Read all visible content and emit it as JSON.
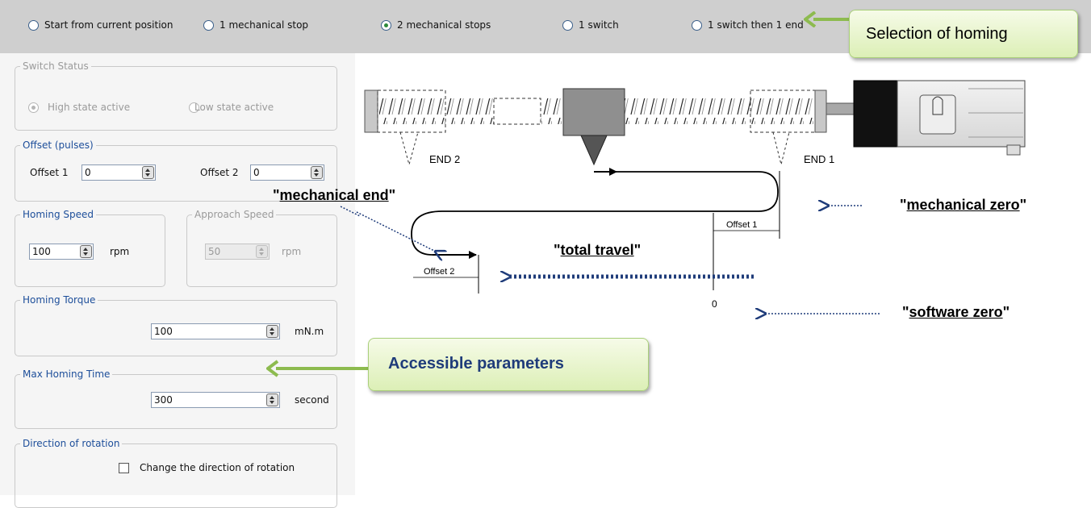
{
  "homing_modes": [
    {
      "label": "Start from current position",
      "selected": false
    },
    {
      "label": "1 mechanical stop",
      "selected": false
    },
    {
      "label": "2 mechanical stops",
      "selected": true
    },
    {
      "label": "1 switch",
      "selected": false
    },
    {
      "label": "1 switch then 1 end",
      "selected": false
    }
  ],
  "callouts": {
    "homing_selection": "Selection of homing",
    "accessible_parameters": "Accessible parameters"
  },
  "switch_status": {
    "title": "Switch Status",
    "high": "High state active",
    "low": "Low state active"
  },
  "offset": {
    "title": "Offset (pulses)",
    "offset1_label": "Offset 1",
    "offset1_value": "0",
    "offset2_label": "Offset 2",
    "offset2_value": "0"
  },
  "homing_speed": {
    "title": "Homing Speed",
    "value": "100",
    "unit": "rpm"
  },
  "approach_speed": {
    "title": "Approach Speed",
    "value": "50",
    "unit": "rpm"
  },
  "homing_torque": {
    "title": "Homing Torque",
    "value": "100",
    "unit": "mN.m"
  },
  "max_homing_time": {
    "title": "Max Homing Time",
    "value": "300",
    "unit": "second"
  },
  "direction": {
    "title": "Direction of rotation",
    "checkbox_label": "Change the direction of rotation",
    "checked": false
  },
  "diagram": {
    "end2": "END 2",
    "end1": "END 1",
    "offset1": "Offset 1",
    "offset2": "Offset 2",
    "zero": "0"
  },
  "annotations": {
    "mechanical_end": "mechanical end",
    "total_travel": "total travel",
    "mechanical_zero": "mechanical zero",
    "software_zero": "software zero"
  },
  "colors": {
    "accent_green": "#8dbb4f",
    "arrow_blue": "#1f3c7a",
    "legend_blue": "#1d4e9a"
  }
}
